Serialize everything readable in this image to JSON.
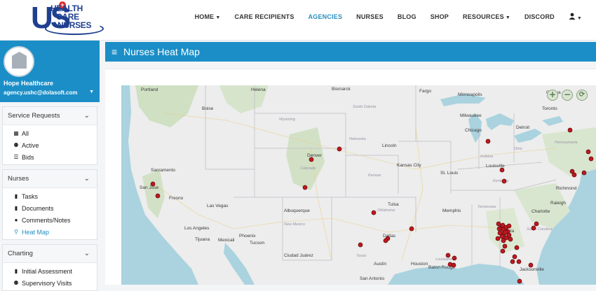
{
  "brand": {
    "logo_text": "US",
    "logo_lines": [
      "HEALTH",
      "CARE",
      "NURSES"
    ]
  },
  "nav": [
    {
      "label": "HOME",
      "caret": true,
      "active": false
    },
    {
      "label": "CARE RECIPIENTS",
      "caret": false,
      "active": false
    },
    {
      "label": "AGENCIES",
      "caret": false,
      "active": true
    },
    {
      "label": "NURSES",
      "caret": false,
      "active": false
    },
    {
      "label": "BLOG",
      "caret": false,
      "active": false
    },
    {
      "label": "SHOP",
      "caret": false,
      "active": false
    },
    {
      "label": "RESOURCES",
      "caret": true,
      "active": false
    },
    {
      "label": "DISCORD",
      "caret": false,
      "active": false
    }
  ],
  "user_menu_icon": "user-icon",
  "profile": {
    "name": "Hope Healthcare",
    "email": "agency.ushc@dolasoft.com"
  },
  "sidebar": {
    "groups": [
      {
        "title": "Service Requests",
        "items": [
          {
            "label": "All",
            "icon": "grid-icon",
            "glyph": "▦"
          },
          {
            "label": "Active",
            "icon": "users-icon",
            "glyph": "👤"
          },
          {
            "label": "Bids",
            "icon": "list-icon",
            "glyph": "☰"
          }
        ]
      },
      {
        "title": "Nurses",
        "items": [
          {
            "label": "Tasks",
            "icon": "clipboard-icon",
            "glyph": "▮"
          },
          {
            "label": "Documents",
            "icon": "clipboard-icon",
            "glyph": "▮"
          },
          {
            "label": "Comments/Notes",
            "icon": "comment-icon",
            "glyph": "●"
          },
          {
            "label": "Heat Map",
            "icon": "map-marker-icon",
            "glyph": "⬤",
            "active": true
          }
        ]
      },
      {
        "title": "Charting",
        "items": [
          {
            "label": "Initial Assessment",
            "icon": "clipboard-icon",
            "glyph": "▮"
          },
          {
            "label": "Supervisory Visits",
            "icon": "user-icon",
            "glyph": "👤"
          }
        ]
      }
    ]
  },
  "page": {
    "title": "Nurses Heat Map"
  },
  "map": {
    "zoom_in": "+",
    "zoom_out": "−",
    "reset": "⟳",
    "colors": {
      "land": "#ecedec",
      "water": "#aad3df",
      "green": "#cfe0c3",
      "marker": "#c0181e"
    },
    "labels": [
      {
        "text": "Portland",
        "kind": "city"
      },
      {
        "text": "Helena",
        "kind": "city"
      },
      {
        "text": "Boise",
        "kind": "city"
      },
      {
        "text": "Fargo",
        "kind": "city"
      },
      {
        "text": "Bismarck",
        "kind": "city"
      },
      {
        "text": "Wyoming",
        "kind": "state"
      },
      {
        "text": "South Dakota",
        "kind": "state"
      },
      {
        "text": "Nebraska",
        "kind": "state"
      },
      {
        "text": "Minneapolis",
        "kind": "city"
      },
      {
        "text": "Milwaukee",
        "kind": "city"
      },
      {
        "text": "Chicago",
        "kind": "city"
      },
      {
        "text": "Ottawa",
        "kind": "city"
      },
      {
        "text": "Toronto",
        "kind": "city"
      },
      {
        "text": "Detroit",
        "kind": "city"
      },
      {
        "text": "Denver",
        "kind": "city"
      },
      {
        "text": "Lincoln",
        "kind": "city"
      },
      {
        "text": "Kansas City",
        "kind": "city"
      },
      {
        "text": "Kansas",
        "kind": "state"
      },
      {
        "text": "Sacramento",
        "kind": "city"
      },
      {
        "text": "San Jose",
        "kind": "city"
      },
      {
        "text": "Fresno",
        "kind": "city"
      },
      {
        "text": "Las Vegas",
        "kind": "city"
      },
      {
        "text": "Los Angeles",
        "kind": "city"
      },
      {
        "text": "Tijuana",
        "kind": "city"
      },
      {
        "text": "Mexicali",
        "kind": "city"
      },
      {
        "text": "Phoenix",
        "kind": "city"
      },
      {
        "text": "Tucson",
        "kind": "city"
      },
      {
        "text": "Albuquerque",
        "kind": "city"
      },
      {
        "text": "New Mexico",
        "kind": "state"
      },
      {
        "text": "Ciudad Juárez",
        "kind": "city"
      },
      {
        "text": "Tulsa",
        "kind": "city"
      },
      {
        "text": "Oklahoma",
        "kind": "state"
      },
      {
        "text": "Dallas",
        "kind": "city"
      },
      {
        "text": "Texas",
        "kind": "state"
      },
      {
        "text": "Austin",
        "kind": "city"
      },
      {
        "text": "Houston",
        "kind": "city"
      },
      {
        "text": "San Antonio",
        "kind": "city"
      },
      {
        "text": "St. Louis",
        "kind": "city"
      },
      {
        "text": "Louisville",
        "kind": "city"
      },
      {
        "text": "Indiana",
        "kind": "state"
      },
      {
        "text": "Ohio",
        "kind": "state"
      },
      {
        "text": "Pennsylvania",
        "kind": "state"
      },
      {
        "text": "Kentucky",
        "kind": "state"
      },
      {
        "text": "Tennessee",
        "kind": "state"
      },
      {
        "text": "Memphis",
        "kind": "city"
      },
      {
        "text": "Atlanta",
        "kind": "city"
      },
      {
        "text": "Charlotte",
        "kind": "city"
      },
      {
        "text": "Raleigh",
        "kind": "city"
      },
      {
        "text": "Richmond",
        "kind": "city"
      },
      {
        "text": "South Carolina",
        "kind": "state"
      },
      {
        "text": "Louisiana",
        "kind": "state"
      },
      {
        "text": "Baton Rouge",
        "kind": "city"
      },
      {
        "text": "Jacksonville",
        "kind": "city"
      },
      {
        "text": "Colorado",
        "kind": "state"
      }
    ],
    "marker_count_note": ""
  }
}
